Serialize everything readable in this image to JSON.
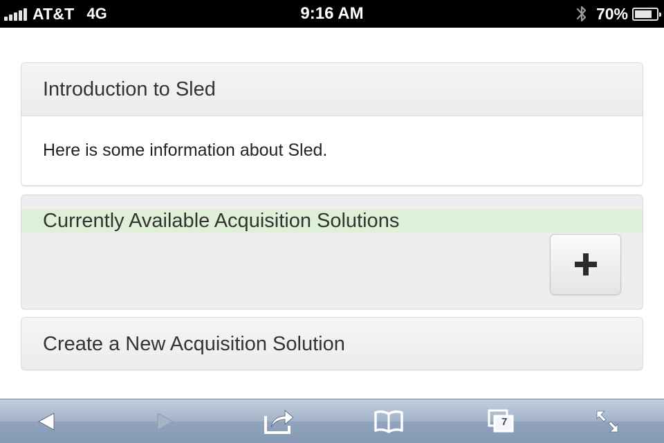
{
  "status_bar": {
    "carrier": "AT&T",
    "network": "4G",
    "time": "9:16 AM",
    "battery_percent": "70%",
    "battery_level": 0.7,
    "signal_icon": "signal-bars-icon",
    "bluetooth_icon": "bluetooth-icon"
  },
  "panels": {
    "intro": {
      "heading": "Introduction to Sled",
      "body": "Here is some information about Sled."
    },
    "available": {
      "heading": "Currently Available Acquisition Solutions",
      "highlight_color": "#dff0d8",
      "add_button_icon": "plus-icon"
    },
    "create": {
      "heading": "Create a New Acquisition Solution"
    }
  },
  "toolbar": {
    "back_icon": "back-arrow-icon",
    "forward_icon": "forward-arrow-icon",
    "share_icon": "share-icon",
    "bookmarks_icon": "bookmarks-book-icon",
    "tabs_icon": "tabs-icon",
    "tabs_count": "7",
    "fullscreen_icon": "fullscreen-icon"
  }
}
